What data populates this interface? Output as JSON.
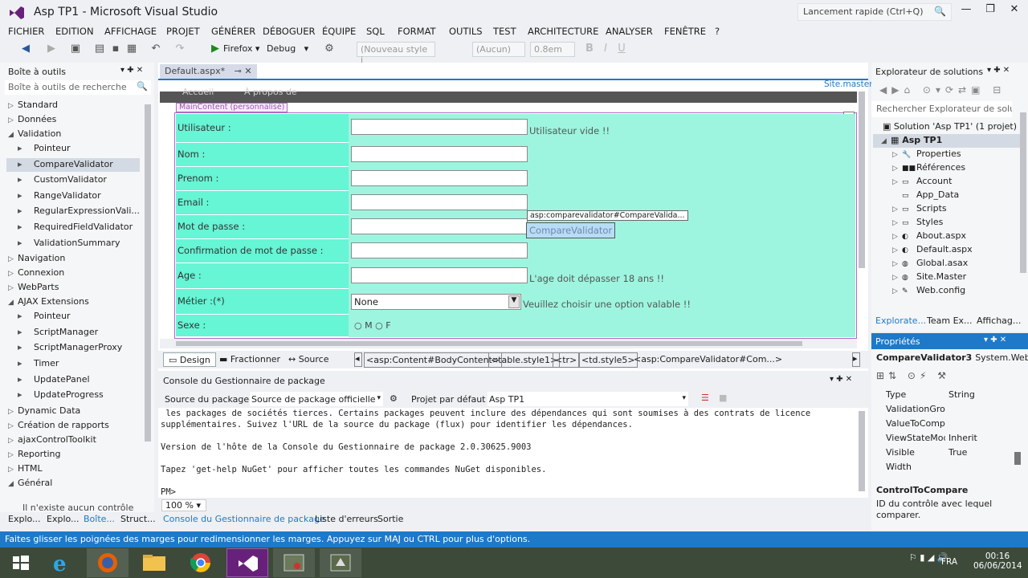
{
  "window": {
    "title": "Asp TP1 - Microsoft Visual Studio",
    "quick_launch": "Lancement rapide (Ctrl+Q)",
    "controls": [
      "—",
      "❐",
      "✕"
    ]
  },
  "menu": [
    "FICHIER",
    "EDITION",
    "AFFICHAGE",
    "PROJET",
    "GÉNÉRER",
    "DÉBOGUER",
    "ÉQUIPE",
    "SQL",
    "FORMAT",
    "OUTILS",
    "TEST",
    "ARCHITECTURE",
    "ANALYSER",
    "FENÊTRE",
    "?"
  ],
  "toolbar": {
    "browser": "Firefox",
    "config": "Debug",
    "style_box": "(Nouveau style i",
    "font_box": "(Aucun)",
    "size_box": "0.8em",
    "bold": "B",
    "italic": "I",
    "underline": "U"
  },
  "toolbox": {
    "title": "Boîte à outils",
    "search": "Boîte à outils de recherche",
    "items": [
      {
        "label": "Standard",
        "indent": 0,
        "tri": "▷"
      },
      {
        "label": "Données",
        "indent": 0,
        "tri": "▷"
      },
      {
        "label": "Validation",
        "indent": 0,
        "tri": "◢"
      },
      {
        "label": "Pointeur",
        "indent": 1,
        "tri": ""
      },
      {
        "label": "CompareValidator",
        "indent": 1,
        "tri": "",
        "selected": true
      },
      {
        "label": "CustomValidator",
        "indent": 1,
        "tri": ""
      },
      {
        "label": "RangeValidator",
        "indent": 1,
        "tri": ""
      },
      {
        "label": "RegularExpressionVali...",
        "indent": 1,
        "tri": ""
      },
      {
        "label": "RequiredFieldValidator",
        "indent": 1,
        "tri": ""
      },
      {
        "label": "ValidationSummary",
        "indent": 1,
        "tri": ""
      },
      {
        "label": "Navigation",
        "indent": 0,
        "tri": "▷"
      },
      {
        "label": "Connexion",
        "indent": 0,
        "tri": "▷"
      },
      {
        "label": "WebParts",
        "indent": 0,
        "tri": "▷"
      },
      {
        "label": "AJAX Extensions",
        "indent": 0,
        "tri": "◢"
      },
      {
        "label": "Pointeur",
        "indent": 1,
        "tri": ""
      },
      {
        "label": "ScriptManager",
        "indent": 1,
        "tri": ""
      },
      {
        "label": "ScriptManagerProxy",
        "indent": 1,
        "tri": ""
      },
      {
        "label": "Timer",
        "indent": 1,
        "tri": ""
      },
      {
        "label": "UpdatePanel",
        "indent": 1,
        "tri": ""
      },
      {
        "label": "UpdateProgress",
        "indent": 1,
        "tri": ""
      },
      {
        "label": "Dynamic Data",
        "indent": 0,
        "tri": "▷"
      },
      {
        "label": "Création de rapports",
        "indent": 0,
        "tri": "▷"
      },
      {
        "label": "ajaxControlToolkit",
        "indent": 0,
        "tri": "▷"
      },
      {
        "label": "Reporting",
        "indent": 0,
        "tri": "▷"
      },
      {
        "label": "HTML",
        "indent": 0,
        "tri": "▷"
      },
      {
        "label": "Général",
        "indent": 0,
        "tri": "◢"
      }
    ],
    "empty_note": "Il n'existe aucun contrôle"
  },
  "left_tabs": [
    "Explo...",
    "Explo...",
    "Boîte...",
    "Struct..."
  ],
  "editor": {
    "tab": "Default.aspx*",
    "site_master": "Site.master",
    "nav_items": [
      "Accueil",
      "À propos de"
    ],
    "content_label": "MainContent (personnalisé)",
    "rows": [
      {
        "label": "Utilisateur :",
        "input": true,
        "msg": "Utilisateur vide !!"
      },
      {
        "label": "Nom :",
        "input": true,
        "msg": ""
      },
      {
        "label": "Prenom :",
        "input": true,
        "msg": ""
      },
      {
        "label": "Email :",
        "input": true,
        "msg": ""
      },
      {
        "label": "Mot de passe :",
        "input": true,
        "msg": ""
      },
      {
        "label": "Confirmation de mot de passe :",
        "input": true,
        "msg": ""
      },
      {
        "label": "Age :",
        "input": true,
        "msg": "L'age doit dépasser 18 ans !!"
      },
      {
        "label": "Métier :(*)",
        "input": false,
        "msg": "Veuillez choisir une option valable !!"
      },
      {
        "label": "Sexe :",
        "input": false,
        "msg": ""
      }
    ],
    "select_value": "None",
    "radio_m": "M",
    "radio_f": "F",
    "tooltip": "asp:comparevalidator#CompareValida...",
    "validator_text": "CompareValidator",
    "view_tabs": [
      "Design",
      "Fractionner",
      "Source"
    ],
    "breadcrumb": [
      "<asp:Content#BodyContent>",
      "<table.style1>",
      "<tr>",
      "<td.style5>",
      "<asp:CompareValidator#Com...>"
    ]
  },
  "console": {
    "title": "Console du Gestionnaire de package",
    "source_label": "Source du package :",
    "source_value": "Source de package officielle",
    "project_label": "Projet par défaut :",
    "project_value": "Asp TP1",
    "lines": [
      " les packages de sociétés tierces. Certains packages peuvent inclure des dépendances qui sont soumises à des contrats de licence",
      "supplémentaires. Suivez l'URL de la source du package (flux) pour identifier les dépendances.",
      "",
      "Version de l'hôte de la Console du Gestionnaire de package 2.0.30625.9003",
      "",
      "Tapez 'get-help NuGet' pour afficher toutes les commandes NuGet disponibles.",
      "",
      "PM>"
    ],
    "zoom": "100 %"
  },
  "bottom_tabs": [
    "Console du Gestionnaire de package",
    "Liste d'erreurs",
    "Sortie"
  ],
  "solution": {
    "title": "Explorateur de solutions",
    "search": "Rechercher Explorateur de solu",
    "root": "Solution 'Asp TP1' (1 projet)",
    "project": "Asp TP1",
    "items": [
      "Properties",
      "Références",
      "Account",
      "App_Data",
      "Scripts",
      "Styles",
      "About.aspx",
      "Default.aspx",
      "Global.asax",
      "Site.Master",
      "Web.config"
    ],
    "tabs": [
      "Explorate...",
      "Team Ex...",
      "Affichag..."
    ]
  },
  "properties": {
    "title": "Propriétés",
    "object": "CompareValidator3",
    "object_type": "System.Web.",
    "rows": [
      {
        "name": "Type",
        "value": "String"
      },
      {
        "name": "ValidationGrou",
        "value": ""
      },
      {
        "name": "ValueToComp",
        "value": ""
      },
      {
        "name": "ViewStateMod",
        "value": "Inherit"
      },
      {
        "name": "Visible",
        "value": "True"
      },
      {
        "name": "Width",
        "value": ""
      }
    ],
    "desc_title": "ControlToCompare",
    "desc_text": "ID du contrôle avec lequel comparer."
  },
  "status": "Faites glisser les poignées des marges pour redimensionner les marges. Appuyez sur MAJ ou CTRL pour plus d'options.",
  "taskbar": {
    "lang": "FRA",
    "time": "00:16",
    "date": "06/06/2014"
  }
}
